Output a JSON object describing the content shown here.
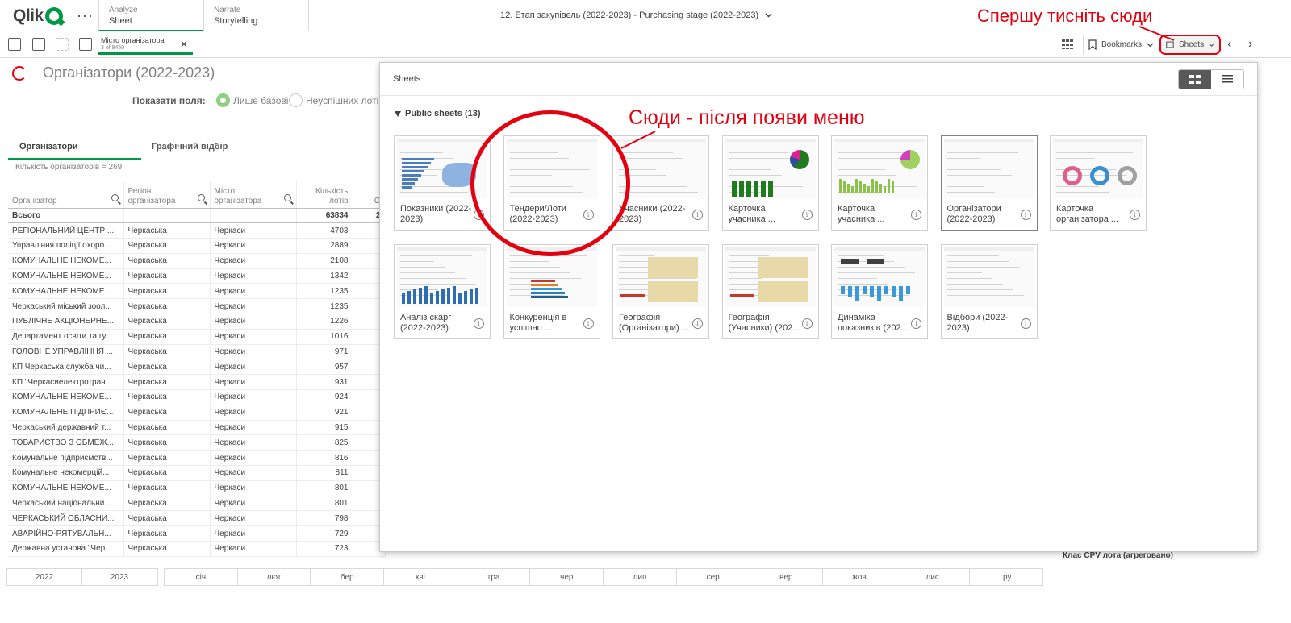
{
  "topbar": {
    "logo": "Qlik",
    "more": "···",
    "tabs": [
      {
        "sub": "Analyze",
        "main": "Sheet"
      },
      {
        "sub": "Narrate",
        "main": "Storytelling"
      }
    ],
    "app_title": "12. Етап закупівель (2022-2023) - Purchasing stage (2022-2023)"
  },
  "toolbar": {
    "selection": {
      "field": "Місто організатора",
      "count": "3 of 9450"
    },
    "bookmarks_label": "Bookmarks",
    "sheets_label": "Sheets"
  },
  "sheet": {
    "title": "Організатори (2022-2023)",
    "show_fields_label": "Показати поля:",
    "radio_basic": "Лише базові",
    "radio_unsuccessful": "Неуспішних лотів",
    "tab_organizers": "Організатори",
    "tab_graphic": "Графічний відбір",
    "org_count": "Кількість організаторів = 269",
    "table": {
      "headers": [
        "Організатор",
        "Регіон\nорганізатора",
        "Місто\nорганізатора",
        "Кількість\nлотів",
        "О"
      ],
      "total": [
        "Всього",
        "",
        "",
        "63834",
        "2"
      ],
      "rows": [
        [
          "РЕГІОНАЛЬНИЙ ЦЕНТР ...",
          "Черкаська",
          "Черкаси",
          "4703"
        ],
        [
          "Управління поліції охоро...",
          "Черкаська",
          "Черкаси",
          "2889"
        ],
        [
          "КОМУНАЛЬНЕ НЕКОМЕ...",
          "Черкаська",
          "Черкаси",
          "2108"
        ],
        [
          "КОМУНАЛЬНЕ НЕКОМЕ...",
          "Черкаська",
          "Черкаси",
          "1342"
        ],
        [
          "КОМУНАЛЬНЕ НЕКОМЕ...",
          "Черкаська",
          "Черкаси",
          "1235"
        ],
        [
          "Черкаський міський зоол...",
          "Черкаська",
          "Черкаси",
          "1235"
        ],
        [
          "ПУБЛІЧНЕ АКЦІОНЕРНЕ...",
          "Черкаська",
          "Черкаси",
          "1226"
        ],
        [
          "Департамент освіти та гу...",
          "Черкаська",
          "Черкаси",
          "1016"
        ],
        [
          "ГОЛОВНЕ УПРАВЛІННЯ ...",
          "Черкаська",
          "Черкаси",
          "971"
        ],
        [
          "КП Черкаська служба чи...",
          "Черкаська",
          "Черкаси",
          "957"
        ],
        [
          "КП \"Черкасиелектротран...",
          "Черкаська",
          "Черкаси",
          "931"
        ],
        [
          "КОМУНАЛЬНЕ НЕКОМЕ...",
          "Черкаська",
          "Черкаси",
          "924"
        ],
        [
          "КОМУНАЛЬНЕ ПІДПРИЄ...",
          "Черкаська",
          "Черкаси",
          "921"
        ],
        [
          "Черкаський державний т...",
          "Черкаська",
          "Черкаси",
          "915"
        ],
        [
          "ТОВАРИСТВО З ОБМЕЖ...",
          "Черкаська",
          "Черкаси",
          "825"
        ],
        [
          "Комунальне підприємств...",
          "Черкаська",
          "Черкаси",
          "816"
        ],
        [
          "Комунальне некомерцій...",
          "Черкаська",
          "Черкаси",
          "811"
        ],
        [
          "КОМУНАЛЬНЕ НЕКОМЕ...",
          "Черкаська",
          "Черкаси",
          "801"
        ],
        [
          "Черкаський національни...",
          "Черкаська",
          "Черкаси",
          "801"
        ],
        [
          "ЧЕРКАСЬКИЙ ОБЛАСНИ...",
          "Черкаська",
          "Черкаси",
          "798"
        ],
        [
          "АВАРІЙНО-РЯТУВАЛЬН...",
          "Черкаська",
          "Черкаси",
          "729"
        ],
        [
          "Державна установа \"Чер...",
          "Черкаська",
          "Черкаси",
          "723"
        ]
      ]
    },
    "years": [
      "2022",
      "2023"
    ],
    "months": [
      "січ",
      "лют",
      "бер",
      "кві",
      "тра",
      "чер",
      "лип",
      "сер",
      "вер",
      "жов",
      "лис",
      "гру"
    ],
    "cpv_label": "Клас CPV лота (агреговано)"
  },
  "panel": {
    "title": "Sheets",
    "public_sheets": "Public sheets (13)",
    "info_glyph": "i",
    "sheets": [
      "Показники (2022-2023)",
      "Тендери/Лоти (2022-2023)",
      "Учасники (2022-2023)",
      "Карточка учасника ...",
      "Карточка учасника ...",
      "Організатори (2022-2023)",
      "Карточка організатора ...",
      "Аналіз скарг (2022-2023)",
      "Конкуренція в успішно ...",
      "Географія (Організатори) ...",
      "Географія (Учасники) (202...",
      "Динаміка показників (202...",
      "Відбори (2022-2023)"
    ]
  },
  "annotations": {
    "first": "Спершу тисніть сюди",
    "second": "Сюди - після появи меню"
  },
  "colors": {
    "qlik_green": "#009845",
    "annotation_red": "#e3000f",
    "selection_green": "#8ed082"
  }
}
